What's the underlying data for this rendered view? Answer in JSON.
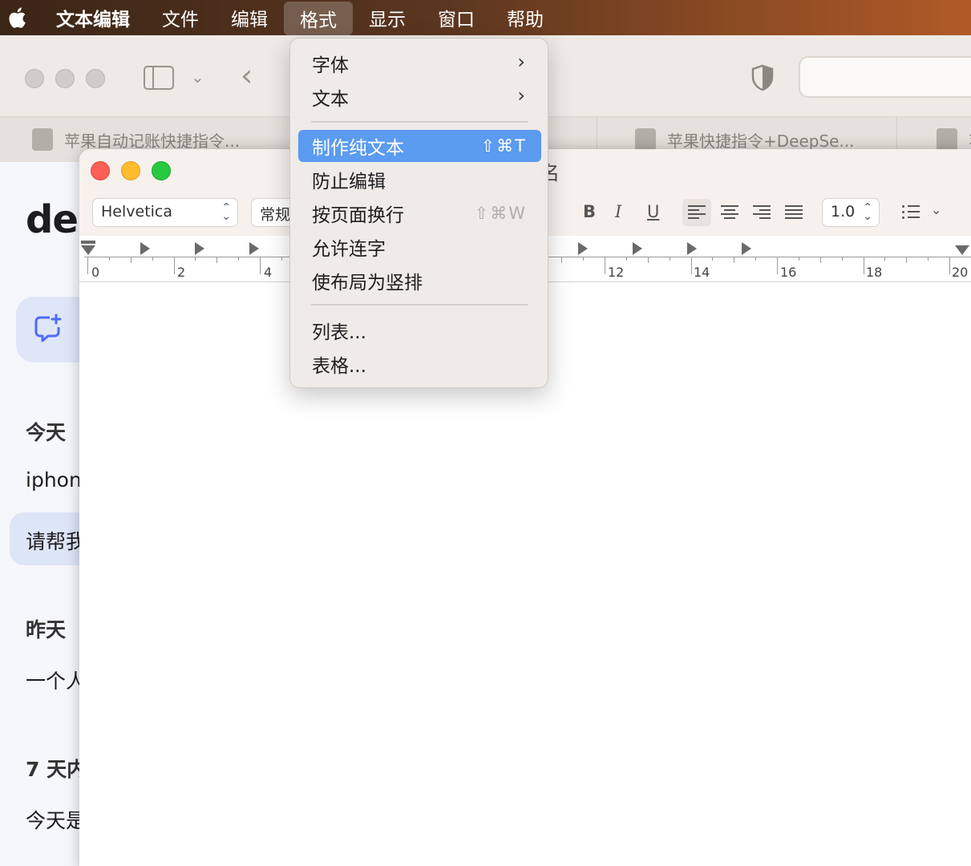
{
  "menubar": {
    "app_name": "文本编辑",
    "items": [
      "文件",
      "编辑",
      "格式",
      "显示",
      "窗口",
      "帮助"
    ],
    "active_item": "格式"
  },
  "browser": {
    "tabs": [
      "苹果自动记账快捷指令...",
      "苹果快捷指令+DeepSe...",
      "苹"
    ]
  },
  "page": {
    "logo": "de",
    "sections": {
      "today": "今天",
      "yesterday": "昨天",
      "seven_days": "7 天内"
    },
    "items": {
      "today_1": "iphon",
      "today_2": "请帮我",
      "yesterday_1": "一个人",
      "week_1": "今天是"
    }
  },
  "textedit": {
    "title_fragment": "名",
    "font": "Helvetica",
    "style": "常规",
    "bold": "B",
    "italic": "I",
    "underline": "U",
    "line_spacing": "1.0",
    "ruler_labels": [
      "0",
      "2",
      "4",
      "12",
      "14",
      "16",
      "18",
      "20"
    ]
  },
  "format_menu": {
    "items": [
      {
        "label": "字体",
        "submenu": true
      },
      {
        "label": "文本",
        "submenu": true
      },
      {
        "label": "制作纯文本",
        "shortcut": "⇧⌘T",
        "highlighted": true
      },
      {
        "label": "防止编辑"
      },
      {
        "label": "按页面换行",
        "shortcut": "⇧⌘W",
        "disabled_shortcut": true
      },
      {
        "label": "允许连字"
      },
      {
        "label": "使布局为竖排"
      },
      {
        "label": "列表..."
      },
      {
        "label": "表格..."
      }
    ],
    "submenu_arrow": "›",
    "colors": {
      "highlight": "#5b9bf0"
    }
  }
}
